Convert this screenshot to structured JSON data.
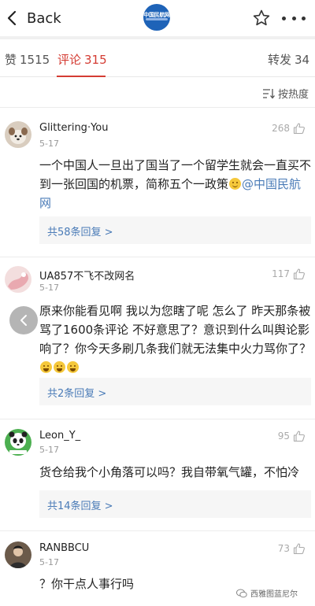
{
  "header": {
    "back_label": "Back",
    "logo_text": "中国民航网"
  },
  "tabs": [
    {
      "label": "赞",
      "count": "1515"
    },
    {
      "label": "评论",
      "count": "315"
    },
    {
      "label": "转发",
      "count": "34"
    }
  ],
  "sort_label": "按热度",
  "comments": [
    {
      "username": "Glittering·You",
      "date": "5-17",
      "likes": "268",
      "text": "一个中国人一旦出了国当了一个留学生就会一直买不到一张回国的机票，简称五个一政策",
      "mention": "@中国民航网",
      "replies": "共58条回复 >"
    },
    {
      "username": "UA857不飞不改网名",
      "date": "5-17",
      "likes": "117",
      "text": "原来你能看见啊 我以为您瞎了呢 怎么了 昨天那条被骂了1600条评论 不好意思了？意识到什么叫舆论影响了？你今天多刷几条我们就无法集中火力骂你了？",
      "replies": "共2条回复 >"
    },
    {
      "username": "Leon_Y_",
      "date": "5-17",
      "likes": "95",
      "text": "货仓给我个小角落可以吗？我自带氧气罐，不怕冷",
      "replies": "共14条回复 >"
    },
    {
      "username": "RANBBCU",
      "date": "5-17",
      "likes": "73",
      "text": "？你干点人事行吗"
    }
  ],
  "watermark": "西雅图蓝尼尔",
  "colors": {
    "accent": "#d43c33",
    "link": "#4a7bb7",
    "logo": "#1e63b8"
  }
}
